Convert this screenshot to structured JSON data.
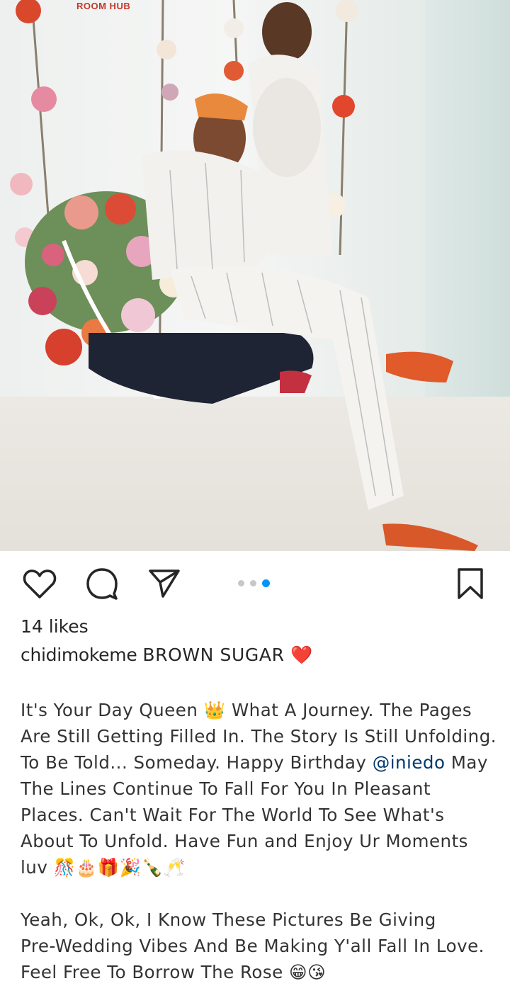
{
  "post": {
    "image_watermark": "ROOM HUB",
    "carousel": {
      "count": 3,
      "active_index": 2
    },
    "likes_text": "14 likes",
    "username": "chidimokeme",
    "caption_title": "BROWN SUGAR ❤️",
    "caption_p1_a": "It's Your Day Queen 👑 What A Journey. The Pages\nAre Still Getting Filled In. The Story Is Still Unfolding.\nTo Be Told... Someday. Happy Birthday ",
    "mention": "@iniedo",
    "caption_p1_b": " May\nThe Lines Continue To Fall For You In Pleasant\nPlaces. Can't Wait For The World To See What's\nAbout To Unfold. Have Fun and Enjoy Ur Moments\nluv 🎊🎂🎁🎉🍾🥂",
    "caption_p2": "Yeah, Ok, Ok, I Know These Pictures Be Giving\nPre-Wedding Vibes And Be Making Y'all Fall In Love.\nFeel Free To Borrow The Rose 😁😘"
  },
  "icons": {
    "like": "heart-icon",
    "comment": "comment-bubble-icon",
    "share": "paper-plane-icon",
    "save": "bookmark-icon"
  },
  "colors": {
    "accent_blue": "#0095f6",
    "text": "#262626",
    "mention": "#00376b"
  }
}
